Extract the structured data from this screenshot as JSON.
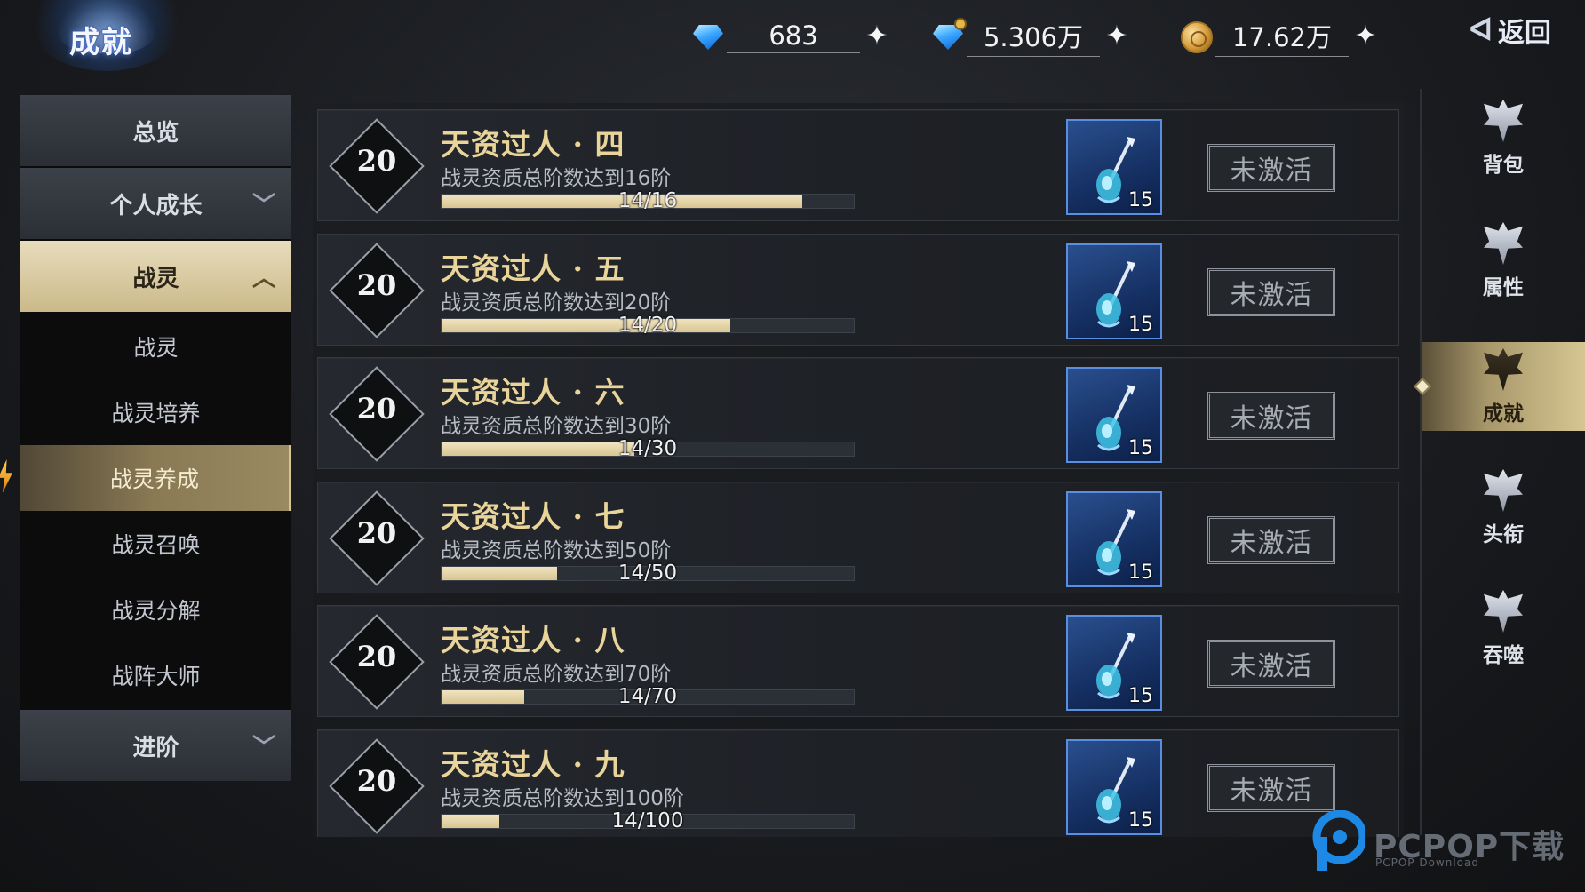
{
  "header": {
    "title": "成就",
    "back_label": "返回"
  },
  "currencies": [
    {
      "icon": "diamond-icon",
      "value": "683"
    },
    {
      "icon": "bound-diamond-icon",
      "value": "5.306万"
    },
    {
      "icon": "gold-coin-icon",
      "value": "17.62万"
    }
  ],
  "left_menu": {
    "overview": "总览",
    "personal_growth": "个人成长",
    "spirit": "战灵",
    "sub_items": [
      "战灵",
      "战灵培养",
      "战灵养成",
      "战灵召唤",
      "战灵分解",
      "战阵大师"
    ],
    "active_sub_index": 2,
    "advance": "进阶"
  },
  "achievements": [
    {
      "points": "20",
      "title": "天资过人 · 四",
      "desc": "战灵资质总阶数达到16阶",
      "current": 14,
      "target": 16,
      "progress_text": "14/16",
      "reward_qty": "15",
      "state": "未激活"
    },
    {
      "points": "20",
      "title": "天资过人 · 五",
      "desc": "战灵资质总阶数达到20阶",
      "current": 14,
      "target": 20,
      "progress_text": "14/20",
      "reward_qty": "15",
      "state": "未激活"
    },
    {
      "points": "20",
      "title": "天资过人 · 六",
      "desc": "战灵资质总阶数达到30阶",
      "current": 14,
      "target": 30,
      "progress_text": "14/30",
      "reward_qty": "15",
      "state": "未激活"
    },
    {
      "points": "20",
      "title": "天资过人 · 七",
      "desc": "战灵资质总阶数达到50阶",
      "current": 14,
      "target": 50,
      "progress_text": "14/50",
      "reward_qty": "15",
      "state": "未激活"
    },
    {
      "points": "20",
      "title": "天资过人 · 八",
      "desc": "战灵资质总阶数达到70阶",
      "current": 14,
      "target": 70,
      "progress_text": "14/70",
      "reward_qty": "15",
      "state": "未激活"
    },
    {
      "points": "20",
      "title": "天资过人 · 九",
      "desc": "战灵资质总阶数达到100阶",
      "current": 14,
      "target": 100,
      "progress_text": "14/100",
      "reward_qty": "15",
      "state": "未激活"
    }
  ],
  "right_nav": {
    "items": [
      "背包",
      "属性",
      "成就",
      "头衔",
      "吞噬"
    ],
    "active_index": 2
  },
  "watermark": {
    "text": "PCPOP下载",
    "sub": "PCPOP Download"
  },
  "colors": {
    "accent_gold": "#e9d49a",
    "progress_fill": "#d8c592",
    "reward_frame": "#5a8ee0"
  }
}
